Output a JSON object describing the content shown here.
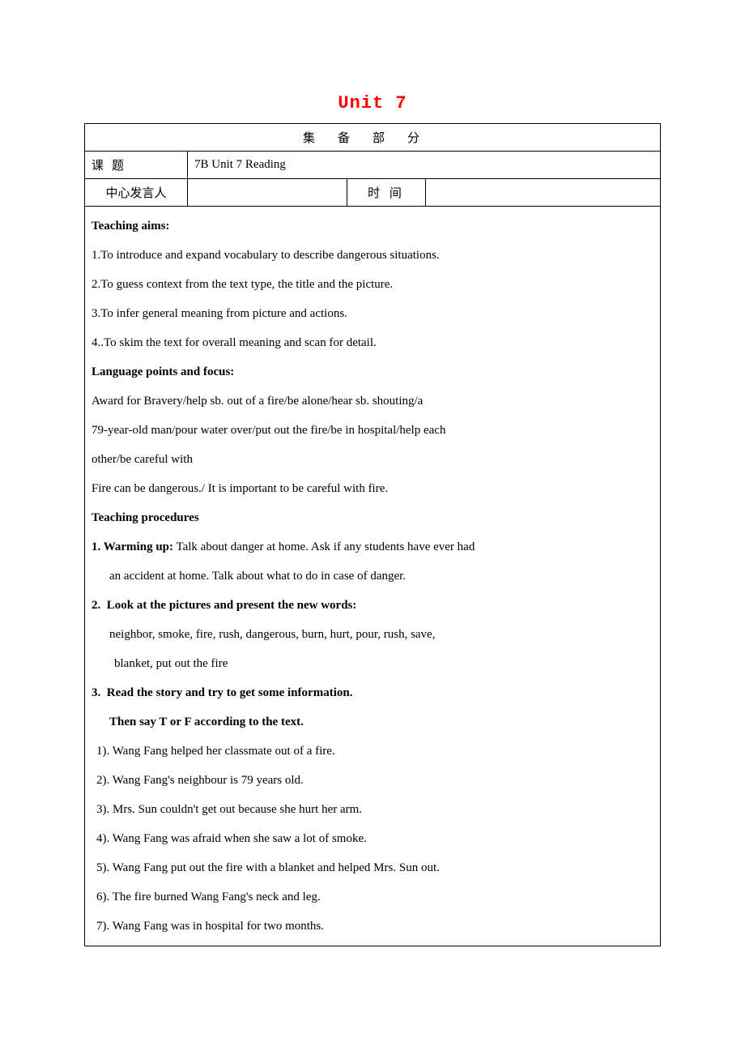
{
  "title": "Unit 7",
  "header_row": "集备部分",
  "row1": {
    "label": "课题",
    "value": "7B Unit 7   Reading"
  },
  "row2": {
    "label1": "中心发言人",
    "value1": "",
    "label2": "时 间",
    "value2": ""
  },
  "content": {
    "aims_heading": "Teaching aims:",
    "aims": [
      "1.To introduce and expand vocabulary to describe dangerous situations.",
      "2.To guess context from the text type, the title and the picture.",
      "3.To infer general meaning from picture and actions.",
      "4..To skim the text for overall meaning and scan for detail."
    ],
    "lang_heading": "Language points and focus:",
    "lang_lines": [
      " Award for Bravery/help sb. out of a fire/be alone/hear sb. shouting/a",
      "79-year-old man/pour water over/put out the fire/be in hospital/help each",
      "other/be careful with",
      "Fire can be dangerous./ It is important to be careful with fire."
    ],
    "proc_heading": "Teaching procedures",
    "p1_bold": "1. Warming up:",
    "p1_rest": " Talk about danger at home. Ask if any students have ever had",
    "p1_line2": "an accident at home. Talk about what to do in case of danger.",
    "p2_num": "2.",
    "p2_bold": "Look at the pictures and present the new words:",
    "p2_line2": "neighbor, smoke, fire, rush, dangerous, burn, hurt, pour, rush, save,",
    "p2_line3": "blanket, put out the fire",
    "p3_num": "3.",
    "p3_bold": "Read the story and try to get some information.",
    "p3_line2": "Then say T or F according to the text.",
    "tf": [
      "1). Wang Fang helped her classmate out of a fire.",
      "2). Wang Fang's neighbour is 79 years old.",
      "3). Mrs. Sun couldn't get out because she hurt her arm.",
      "4). Wang Fang was afraid when she saw a lot of smoke.",
      "5). Wang Fang put out the fire with a blanket and helped Mrs. Sun out.",
      "6). The fire burned Wang Fang's neck and leg.",
      "7). Wang Fang was in hospital for two months."
    ]
  }
}
